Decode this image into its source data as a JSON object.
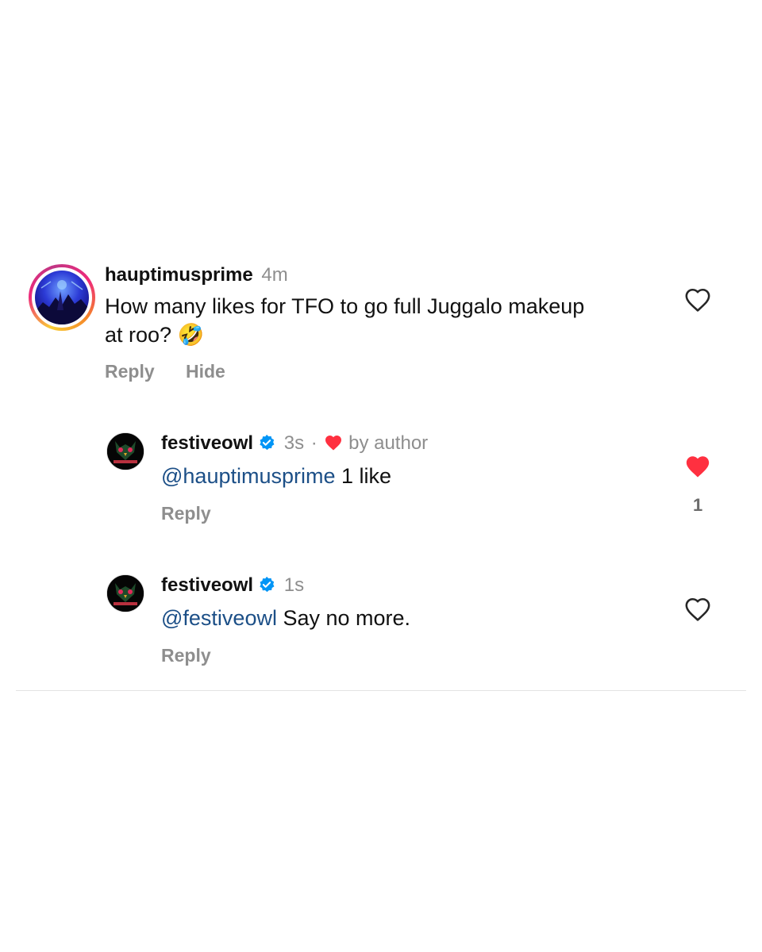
{
  "comments": [
    {
      "username": "hauptimusprime",
      "time": "4m",
      "text_line1": "How many likes for TFO to go full Juggalo makeup",
      "text_line2": "at roo?",
      "emoji": "🤣",
      "actions": [
        "Reply",
        "Hide"
      ],
      "liked": false
    }
  ],
  "replies": [
    {
      "username": "festiveowl",
      "verified": true,
      "time": "3s",
      "separator": "·",
      "liked_by_author": "by author",
      "mention": "@hauptimusprime",
      "text": "1 like",
      "action": "Reply",
      "liked": true,
      "like_count": "1"
    },
    {
      "username": "festiveowl",
      "verified": true,
      "time": "1s",
      "mention": "@festiveowl",
      "text": "Say no more.",
      "action": "Reply",
      "liked": false
    }
  ],
  "colors": {
    "like_red": "#ff3040",
    "verified_blue": "#0095f6",
    "mention_blue": "#1c4f87",
    "muted_gray": "#8e8e8e"
  },
  "icons": [
    "heart-outline-icon",
    "heart-filled-icon",
    "verified-badge-icon"
  ]
}
